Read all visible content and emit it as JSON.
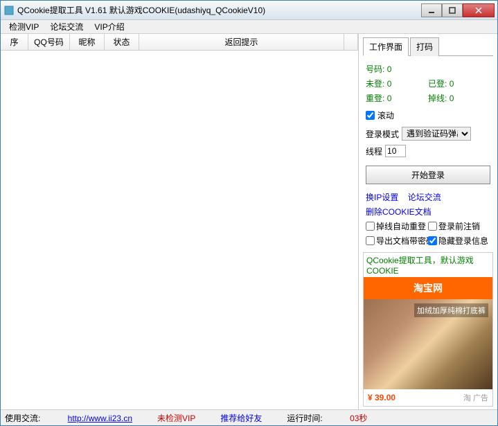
{
  "window": {
    "title": "QCookie提取工具 V1.61 默认游戏COOKIE(udashiyq_QCookieV10)"
  },
  "menu": {
    "items": [
      "检测VIP",
      "论坛交流",
      "VIP介绍"
    ]
  },
  "table": {
    "headers": [
      "序",
      "QQ号码",
      "昵称",
      "状态",
      "返回提示"
    ]
  },
  "tabs": {
    "work": "工作界面",
    "dama": "打码"
  },
  "stats": {
    "haoma_label": "号码:",
    "haoma_val": "0",
    "weideng_label": "未登:",
    "weideng_val": "0",
    "yideng_label": "已登:",
    "yideng_val": "0",
    "chongdeng_label": "重登:",
    "chongdeng_val": "0",
    "diaoxian_label": "掉线:",
    "diaoxian_val": "0"
  },
  "form": {
    "gundong": "滚动",
    "login_mode_label": "登录模式",
    "login_mode_value": "遇到验证码弹出",
    "thread_label": "线程",
    "thread_value": "10",
    "start_button": "开始登录",
    "huanip": "换IP设置",
    "forum": "论坛交流",
    "delete_cookie": "删除COOKIE文档",
    "diaoxian_auto": "掉线自动重登",
    "logout_before": "登录前注销",
    "export_pwd": "导出文档带密码",
    "hide_login": "隐藏登录信息"
  },
  "ad": {
    "title": "QCookie提取工具，默认游戏COOKIE",
    "banner": "淘宝网",
    "img_text": "加绒加厚纯棉打底裤",
    "price": "¥ 39.00",
    "tag": "淘 广告"
  },
  "status": {
    "contact_label": "使用交流: ",
    "contact_url": "http://www.ii23.cn",
    "vip_status": "未检测VIP",
    "recommend": "推荐给好友",
    "runtime_label": "运行时间: ",
    "runtime_val": "03秒"
  }
}
